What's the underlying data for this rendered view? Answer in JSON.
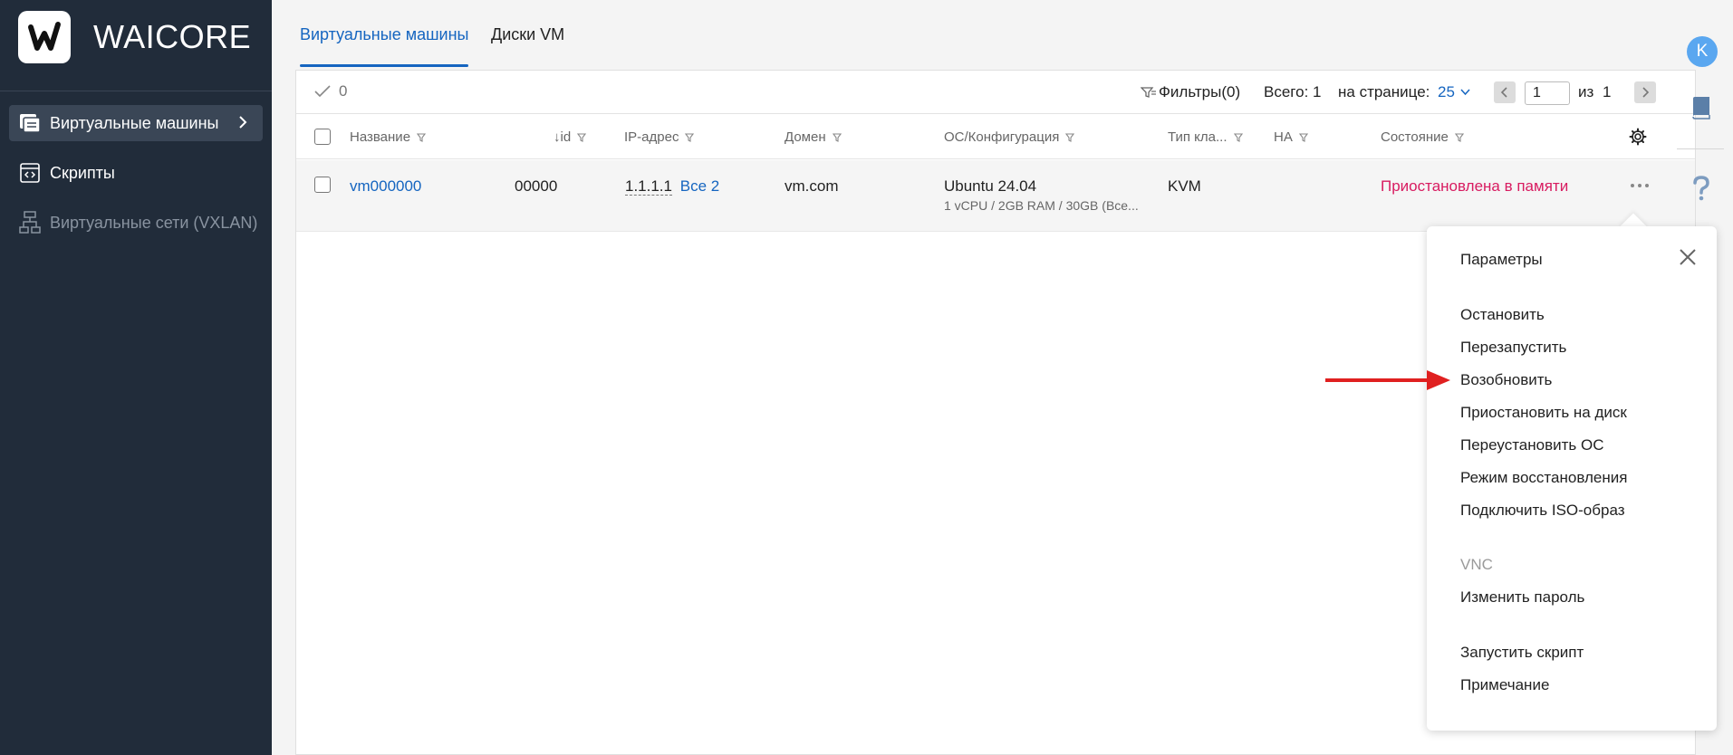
{
  "brand": {
    "name": "WAICORE",
    "logo_letter": "W"
  },
  "sidebar": {
    "items": [
      {
        "label": "Виртуальные машины",
        "icon": "vm-list-icon",
        "active": true
      },
      {
        "label": "Скрипты",
        "icon": "script-icon",
        "active": false
      },
      {
        "label": "Виртуальные сети (VXLAN)",
        "icon": "network-icon",
        "active": false,
        "disabled": true
      }
    ]
  },
  "tabs": [
    {
      "label": "Виртуальные машины",
      "active": true
    },
    {
      "label": "Диски VM",
      "active": false
    }
  ],
  "toolbar": {
    "selected_count": "0",
    "filters_label": "Фильтры(0)",
    "total_label": "Всего: 1",
    "per_page_label": "на странице:",
    "per_page_value": "25",
    "page_value": "1",
    "page_of_label": "из",
    "page_total": "1"
  },
  "table": {
    "columns": [
      "Название",
      "↓id",
      "IP-адрес",
      "Домен",
      "ОС/Конфигурация",
      "Тип кла...",
      "HA",
      "Состояние"
    ],
    "rows": [
      {
        "name": "vm000000",
        "id": "00000",
        "ip": "1.1.1.1",
        "ip_all": "Все 2",
        "domain": "vm.com",
        "os": "Ubuntu 24.04",
        "config": "1 vCPU / 2GB RAM / 30GB (Все...",
        "type": "KVM",
        "ha": "",
        "status": "Приостановлена в памяти"
      }
    ]
  },
  "menu": {
    "items": [
      {
        "label": "Параметры"
      },
      {
        "label": "Остановить"
      },
      {
        "label": "Перезапустить"
      },
      {
        "label": "Возобновить",
        "highlighted": true
      },
      {
        "label": "Приостановить на диск"
      },
      {
        "label": "Переустановить ОС"
      },
      {
        "label": "Режим восстановления"
      },
      {
        "label": "Подключить ISO-образ"
      },
      {
        "label": "VNC",
        "disabled": true
      },
      {
        "label": "Изменить пароль"
      },
      {
        "label": "Запустить скрипт"
      },
      {
        "label": "Примечание"
      }
    ]
  },
  "rail": {
    "avatar_letter": "K"
  },
  "colors": {
    "accent": "#1565c0",
    "sidebar_bg": "#212c3a",
    "status": "#d81b60",
    "arrow": "#e02020"
  }
}
